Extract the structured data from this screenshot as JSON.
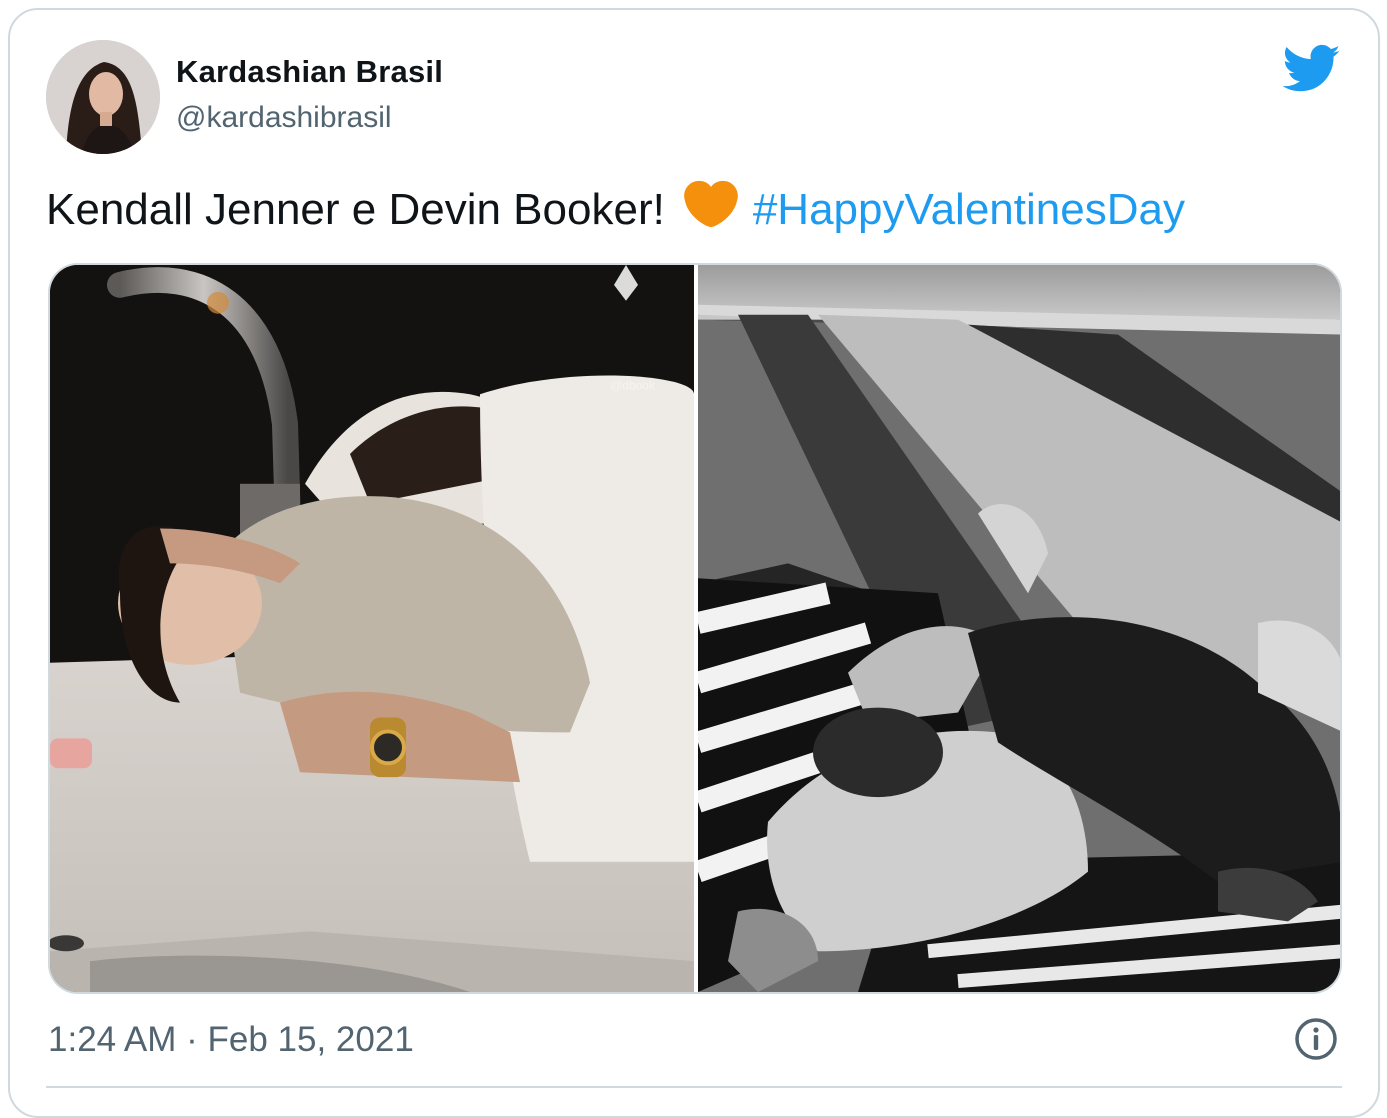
{
  "tweet": {
    "author": {
      "display_name": "Kardashian Brasil",
      "handle": "@kardashibrasil",
      "avatar": "profile-photo"
    },
    "text": {
      "before_emoji": "Kendall Jenner e Devin Booker!",
      "emoji": "orange-heart",
      "hashtag": "#HappyValentinesDay"
    },
    "media": [
      {
        "name": "kitchen-counter-hug-photo",
        "watermark": "@dbook"
      },
      {
        "name": "grass-picnic-blanket-photo"
      }
    ],
    "timestamp": "1:24 AM · Feb 15, 2021",
    "icons": {
      "brand": "twitter-bird-icon",
      "info": "info-icon"
    }
  },
  "colors": {
    "brand_blue": "#1d9bf0",
    "hashtag": "#1d9bf0",
    "heart": "#f4900c",
    "secondary_text": "#536471",
    "border": "#cfd9de"
  }
}
